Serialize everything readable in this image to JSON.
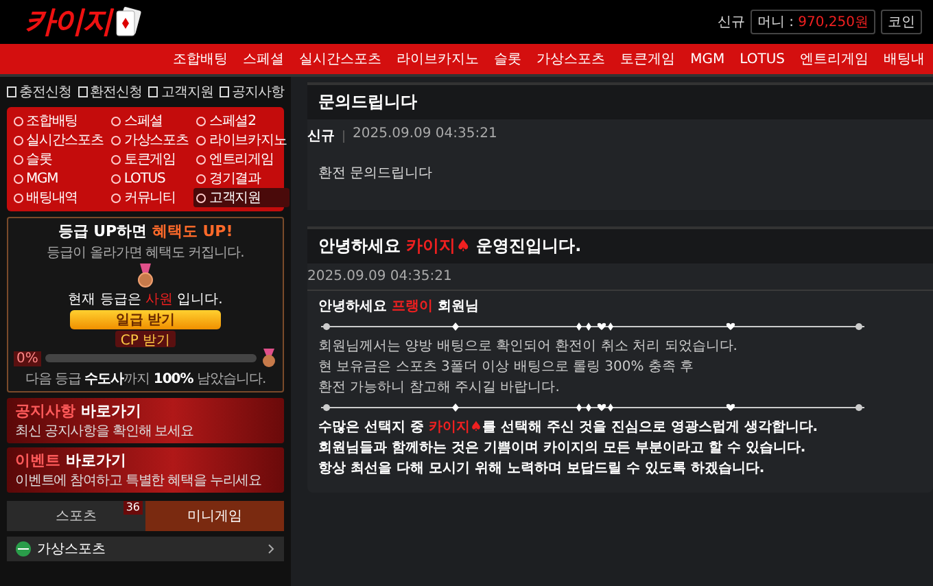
{
  "logo": {
    "text": "카이지"
  },
  "header": {
    "user_badge": "신규",
    "money_label": "머니 : ",
    "money_value": "970,250원",
    "coin_label": "코인"
  },
  "nav": [
    "조합배팅",
    "스페셜",
    "실시간스포츠",
    "라이브카지노",
    "슬롯",
    "가상스포츠",
    "토큰게임",
    "MGM",
    "LOTUS",
    "엔트리게임",
    "배팅내"
  ],
  "sidebar": {
    "quick_links": [
      "충전신청",
      "환전신청",
      "고객지원",
      "공지사항"
    ],
    "menu": [
      {
        "label": "조합배팅",
        "selected": false
      },
      {
        "label": "스페셜",
        "selected": false
      },
      {
        "label": "스페셜2",
        "selected": false
      },
      {
        "label": "실시간스포츠",
        "selected": false
      },
      {
        "label": "가상스포츠",
        "selected": false
      },
      {
        "label": "라이브카지노",
        "selected": false
      },
      {
        "label": "슬롯",
        "selected": false
      },
      {
        "label": "토큰게임",
        "selected": false
      },
      {
        "label": "엔트리게임",
        "selected": false
      },
      {
        "label": "MGM",
        "selected": false
      },
      {
        "label": "LOTUS",
        "selected": false
      },
      {
        "label": "경기결과",
        "selected": false
      },
      {
        "label": "배팅내역",
        "selected": false
      },
      {
        "label": "커뮤니티",
        "selected": false
      },
      {
        "label": "고객지원",
        "selected": true
      }
    ],
    "grade": {
      "title": "등급 UP하면 ",
      "title_highlight": "혜택도 UP!",
      "subtitle": "등급이 올라가면 혜택도 커집니다.",
      "current_prefix": "현재 등급은 ",
      "current_grade": "사원",
      "current_suffix": " 입니다.",
      "claim_button": "일급 받기",
      "cp_button": "CP 받기",
      "percent": "0%",
      "level": 0,
      "next_text": "다음 등급 **수도사**까지 **100%** 남았습니다."
    },
    "banners": [
      {
        "title": "공지사항",
        "title_rest": " 바로가기",
        "subtitle": "최신 공지사항을 확인해 보세요"
      },
      {
        "title": "이벤트",
        "title_rest": " 바로가기",
        "subtitle": "이벤트에 참여하고 특별한 혜택을 누리세요"
      }
    ],
    "tabs": [
      {
        "label": "스포츠",
        "selected": false,
        "badge": "36"
      },
      {
        "label": "미니게임",
        "selected": true
      }
    ],
    "list_item": {
      "label": "가상스포츠"
    }
  },
  "inquiry": {
    "title": "문의드립니다",
    "badge": "신규",
    "date": "2025.09.09 04:35:21",
    "body": "환전 문의드립니다"
  },
  "reply": {
    "title": [
      {
        "text": "안녕하세요 ",
        "highlight": false
      },
      {
        "text": "카이지♠",
        "highlight": true
      },
      {
        "text": " 운영진입니다.",
        "highlight": false
      }
    ],
    "date": "2025.09.09 04:35:21",
    "blocks": [
      {
        "kind": "text",
        "bold": true,
        "parts": [
          {
            "text": "안녕하세요 ",
            "highlight": false
          },
          {
            "text": "프랭이",
            "highlight": true
          },
          {
            "text": " 회원님",
            "highlight": false
          }
        ]
      },
      {
        "kind": "divider"
      },
      {
        "kind": "text",
        "bold": false,
        "parts": [
          {
            "text": "회원님께서는 양방 배팅으로 확인되어 환전이 취소 처리 되었습니다.",
            "highlight": false
          }
        ]
      },
      {
        "kind": "text",
        "bold": false,
        "parts": [
          {
            "text": "현 보유금은 스포츠 3폴더 이상 배팅으로 롤링 300% 충족 후",
            "highlight": false
          }
        ]
      },
      {
        "kind": "text",
        "bold": false,
        "parts": [
          {
            "text": "환전 가능하니 참고해 주시길 바랍니다.",
            "highlight": false
          }
        ]
      },
      {
        "kind": "divider"
      },
      {
        "kind": "text",
        "bold": true,
        "parts": [
          {
            "text": "수많은 선택지 중 ",
            "highlight": false
          },
          {
            "text": "카이지♠",
            "highlight": true
          },
          {
            "text": "를 선택해 주신 것을 진심으로 영광스럽게 생각합니다.",
            "highlight": false
          }
        ]
      },
      {
        "kind": "text",
        "bold": true,
        "parts": [
          {
            "text": "회원님들과 함께하는 것은 기쁨이며 카이지의 모든 부분이라고 할 수 있습니다.",
            "highlight": false
          }
        ]
      },
      {
        "kind": "text",
        "bold": true,
        "parts": [
          {
            "text": "항상 최선을 다해 모시기 위해 노력하며 보답드릴 수 있도록 하겠습니다.",
            "highlight": false
          }
        ]
      }
    ]
  }
}
